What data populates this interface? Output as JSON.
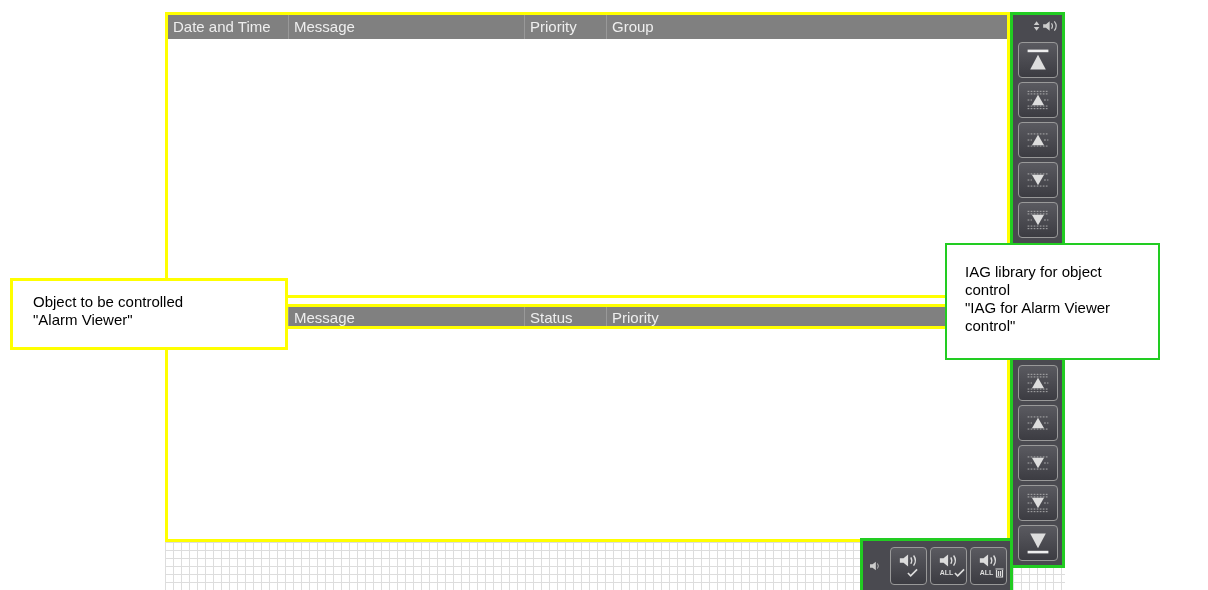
{
  "alarm_viewer": {
    "top_table": {
      "columns": [
        "Date and Time",
        "Message",
        "Priority",
        "Group"
      ]
    },
    "bottom_table": {
      "columns": [
        "Message",
        "Status",
        "Priority"
      ]
    }
  },
  "scroll_toolbar": {
    "top_buttons": [
      {
        "kind": "first"
      },
      {
        "kind": "page-up"
      },
      {
        "kind": "up"
      },
      {
        "kind": "down"
      },
      {
        "kind": "page-down"
      }
    ],
    "bottom_buttons": [
      {
        "kind": "page-up"
      },
      {
        "kind": "up"
      },
      {
        "kind": "down"
      },
      {
        "kind": "page-down"
      },
      {
        "kind": "last"
      }
    ]
  },
  "acknowledge_bar": {
    "buttons": [
      {
        "kind": "ack"
      },
      {
        "kind": "ack-all",
        "label": "ALL"
      },
      {
        "kind": "delete-all",
        "label": "ALL"
      }
    ]
  },
  "callouts": [
    {
      "kind": "viewer",
      "text": "Object to be controlled\n\"Alarm Viewer\""
    },
    {
      "kind": "library",
      "text": "IAG library for object control\n\"IAG for Alarm Viewer control\""
    }
  ]
}
